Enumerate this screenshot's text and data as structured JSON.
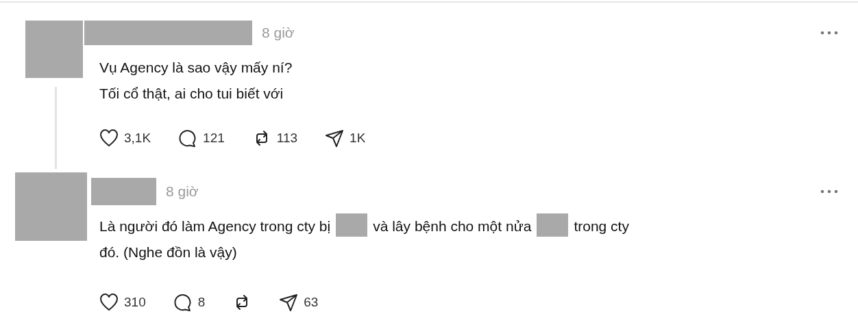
{
  "posts": [
    {
      "time": "8 giờ",
      "body": [
        {
          "kind": "text",
          "text": "Vụ Agency là sao vậy mấy ní?"
        },
        {
          "kind": "break"
        },
        {
          "kind": "text",
          "text": "Tối cổ thật, ai cho tui biết với"
        }
      ],
      "actions": [
        {
          "kind": "like",
          "count": "3,1K"
        },
        {
          "kind": "comment",
          "count": "121"
        },
        {
          "kind": "repost",
          "count": "113"
        },
        {
          "kind": "share",
          "count": "1K"
        }
      ],
      "thread_line": true
    },
    {
      "time": "8 giờ",
      "body": [
        {
          "kind": "text",
          "text": "Là người đó làm Agency trong cty bị"
        },
        {
          "kind": "redacted"
        },
        {
          "kind": "text",
          "text": "và lây bệnh cho một nửa"
        },
        {
          "kind": "redacted"
        },
        {
          "kind": "text",
          "text": "trong cty"
        },
        {
          "kind": "break"
        },
        {
          "kind": "text",
          "text": "đó. (Nghe đồn là vậy)"
        }
      ],
      "actions": [
        {
          "kind": "like",
          "count": "310"
        },
        {
          "kind": "comment",
          "count": "8"
        },
        {
          "kind": "repost"
        },
        {
          "kind": "share",
          "count": "63"
        }
      ],
      "thread_line": false
    }
  ]
}
